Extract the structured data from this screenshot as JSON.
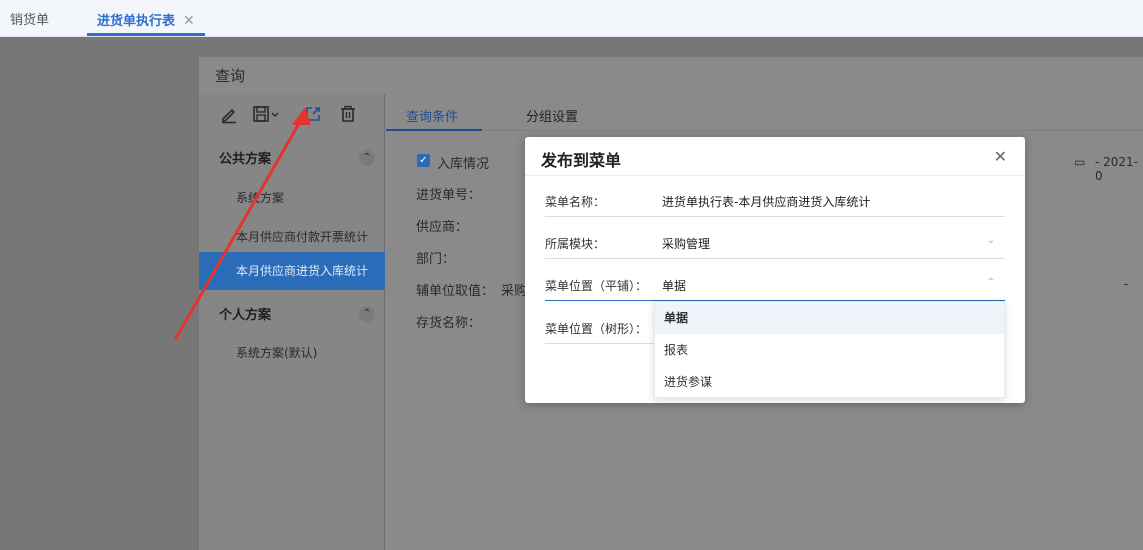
{
  "tabs": [
    {
      "label": "销货单"
    },
    {
      "label": "进货单执行表",
      "close": "✕"
    }
  ],
  "query": {
    "title": "查询",
    "left": {
      "public_section": "公共方案",
      "public_items": [
        "系统方案",
        "本月供应商付款开票统计",
        "本月供应商进货入库统计"
      ],
      "personal_section": "个人方案",
      "personal_items": [
        "系统方案(默认)"
      ]
    },
    "right": {
      "tabs": [
        "查询条件",
        "分组设置"
      ],
      "checkbox_label": "入库情况",
      "fields": [
        "进货单号：",
        "供应商：",
        "部门：",
        "辅单位取值：",
        "存货名称："
      ],
      "aux_value": "采购",
      "date_text": "- 2021-0",
      "dash": "-"
    }
  },
  "dialog": {
    "title": "发布到菜单",
    "close": "✕",
    "rows": [
      {
        "label": "菜单名称：",
        "value": "进货单执行表-本月供应商进货入库统计"
      },
      {
        "label": "所属模块：",
        "value": "采购管理"
      },
      {
        "label": "菜单位置（平铺）：",
        "value": "单据"
      },
      {
        "label": "菜单位置（树形）：",
        "value": ""
      }
    ],
    "options": [
      "单据",
      "报表",
      "进货参谋"
    ]
  },
  "colors": {
    "accent": "#2b6cb8",
    "arrow": "#e3342f"
  }
}
